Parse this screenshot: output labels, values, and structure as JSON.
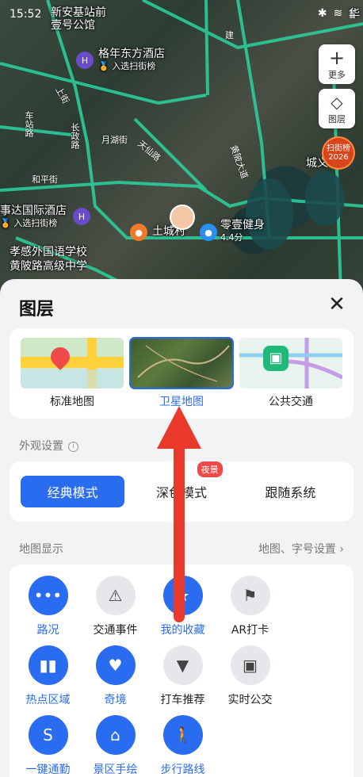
{
  "status": {
    "time": "15:52",
    "carrier": "华"
  },
  "map": {
    "pois": {
      "xinan": "新安基站前",
      "xinan_sub": "壹号公馆",
      "gnf_hotel": "格年东方酒店",
      "gnf_rank": "入选扫街榜",
      "guoji_hotel": "国际酒店",
      "guoji_prefix": "事达",
      "guoji_rank": "入选扫街榜",
      "tucheng": "土城村",
      "lingyi": "零壹健身",
      "lingyi_score": "4.4分",
      "school1": "孝感外国语学校",
      "school2": "黄陂路高级中学",
      "chengyi": "城义"
    },
    "roads": {
      "r1": "上街",
      "r2": "长政路",
      "r3": "天仙路",
      "r4": "月湖街",
      "r5": "和平街",
      "r6": "车站路",
      "r7": "黄陂大道",
      "r8": "建"
    },
    "buttons": {
      "more": "更多",
      "layers": "图层"
    },
    "badge": {
      "line1": "扫街榜",
      "line2": "2026"
    }
  },
  "sheet": {
    "title": "图层",
    "layers": [
      {
        "label": "标准地图",
        "selected": false
      },
      {
        "label": "卫星地图",
        "selected": true
      },
      {
        "label": "公共交通",
        "selected": false
      }
    ],
    "appearance": {
      "title": "外观设置",
      "modes": [
        {
          "label": "经典模式",
          "active": true
        },
        {
          "label": "深色模式",
          "active": false,
          "tag": "夜景"
        },
        {
          "label": "跟随系统",
          "active": false
        }
      ]
    },
    "display": {
      "title": "地图显示",
      "settings_link": "地图、字号设置",
      "items": [
        {
          "label": "路况",
          "icon": "traffic-icon",
          "on": true
        },
        {
          "label": "交通事件",
          "icon": "traffic-event-icon",
          "on": false
        },
        {
          "label": "我的收藏",
          "icon": "favorites-icon",
          "on": true
        },
        {
          "label": "AR打卡",
          "icon": "flag-icon",
          "on": false
        },
        {
          "label": "热点区域",
          "icon": "hot-area-icon",
          "on": true
        },
        {
          "label": "奇境",
          "icon": "wonderland-icon",
          "on": true
        },
        {
          "label": "打车推荐",
          "icon": "taxi-icon",
          "on": false
        },
        {
          "label": "实时公交",
          "icon": "bus-icon",
          "on": false
        },
        {
          "label": "一键通勤",
          "icon": "commute-icon",
          "on": true
        },
        {
          "label": "景区手绘",
          "icon": "scenic-icon",
          "on": true
        },
        {
          "label": "步行路线",
          "icon": "walk-icon",
          "on": true
        }
      ]
    }
  },
  "colors": {
    "accent": "#2a6cf0",
    "arrow": "#e8392b",
    "road": "#2bd4a0"
  }
}
